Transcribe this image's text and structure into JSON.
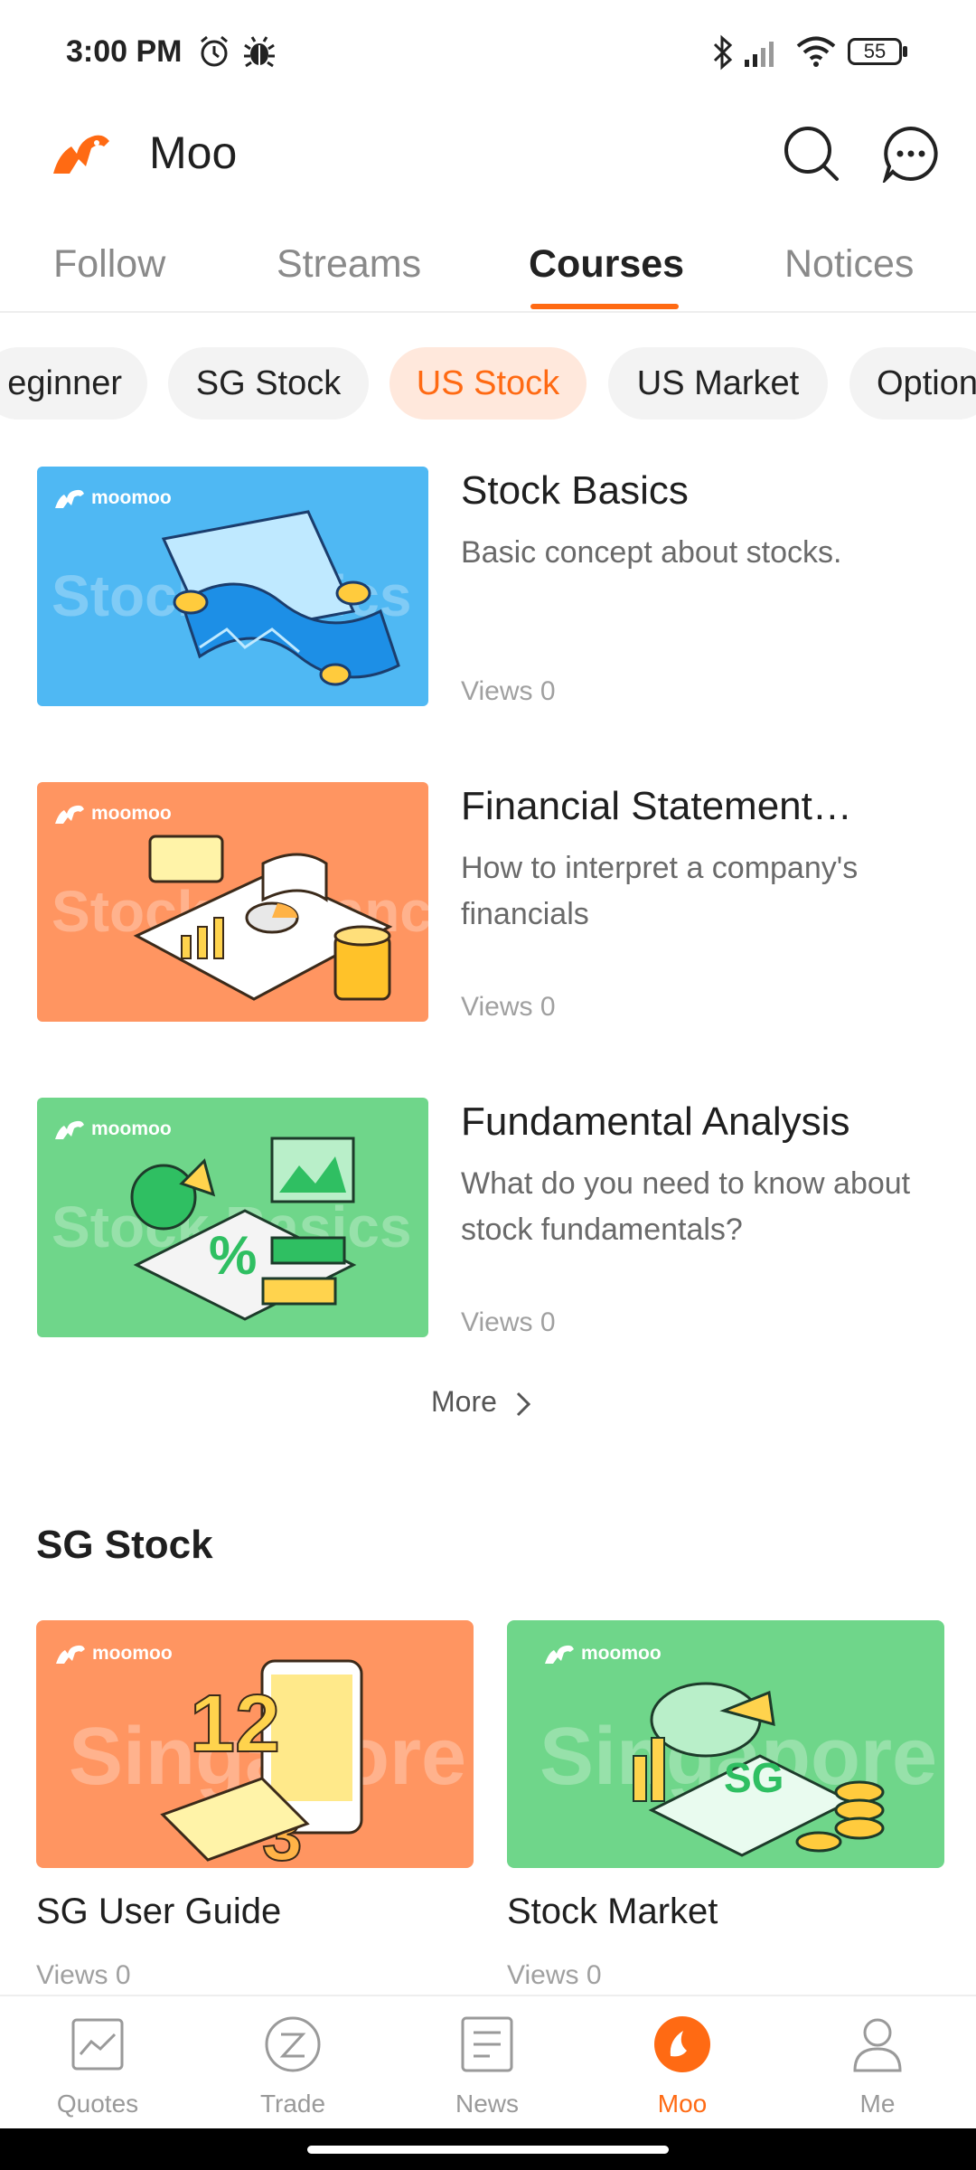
{
  "status_bar": {
    "time": "3:00 PM",
    "battery": "55",
    "icons": [
      "alarm-icon",
      "bug-icon",
      "bluetooth-icon",
      "signal-icon",
      "wifi-icon",
      "battery-icon"
    ]
  },
  "header": {
    "title": "Moo",
    "icons": [
      "moomoo-logo-icon",
      "search-icon",
      "message-icon"
    ]
  },
  "top_tabs": [
    {
      "label": "Follow"
    },
    {
      "label": "Streams"
    },
    {
      "label": "Courses",
      "active": true
    },
    {
      "label": "Notices"
    }
  ],
  "chips": [
    {
      "label": "eginner"
    },
    {
      "label": "SG Stock"
    },
    {
      "label": "US Stock",
      "active": true
    },
    {
      "label": "US Market"
    },
    {
      "label": "Option"
    }
  ],
  "courses": [
    {
      "brand": "moomoo",
      "bg_word": "Stock Basics",
      "title": "Stock Basics",
      "description": "Basic concept about stocks.",
      "views": "Views 0",
      "color": "#4fb8f3"
    },
    {
      "brand": "moomoo",
      "bg_word": "Stock Advanced",
      "title": "Financial Statement…",
      "description": "How to interpret a company's financials",
      "views": "Views 0",
      "color": "#ff9561"
    },
    {
      "brand": "moomoo",
      "bg_word": "Stock Basics",
      "title": "Fundamental Analysis",
      "description": "What do you need to know about stock fundamentals?",
      "views": "Views 0",
      "color": "#6fd68a"
    }
  ],
  "more_label": "More",
  "section": {
    "title": "SG Stock",
    "cards": [
      {
        "brand": "moomoo",
        "bg_word": "Singapore",
        "title": "SG User Guide",
        "views": "Views 0",
        "color": "#ff9561"
      },
      {
        "brand": "moomoo",
        "bg_word": "Singapore",
        "title": "Stock Market",
        "views": "Views 0",
        "color": "#6fd68a"
      }
    ]
  },
  "bottom_nav": [
    {
      "label": "Quotes",
      "icon": "chart-icon"
    },
    {
      "label": "Trade",
      "icon": "trade-icon"
    },
    {
      "label": "News",
      "icon": "news-icon"
    },
    {
      "label": "Moo",
      "icon": "moo-icon",
      "active": true
    },
    {
      "label": "Me",
      "icon": "person-icon"
    }
  ],
  "colors": {
    "accent": "#ff6a13",
    "chip_active_bg": "#ffe8dc",
    "chip_bg": "#f3f3f3"
  }
}
